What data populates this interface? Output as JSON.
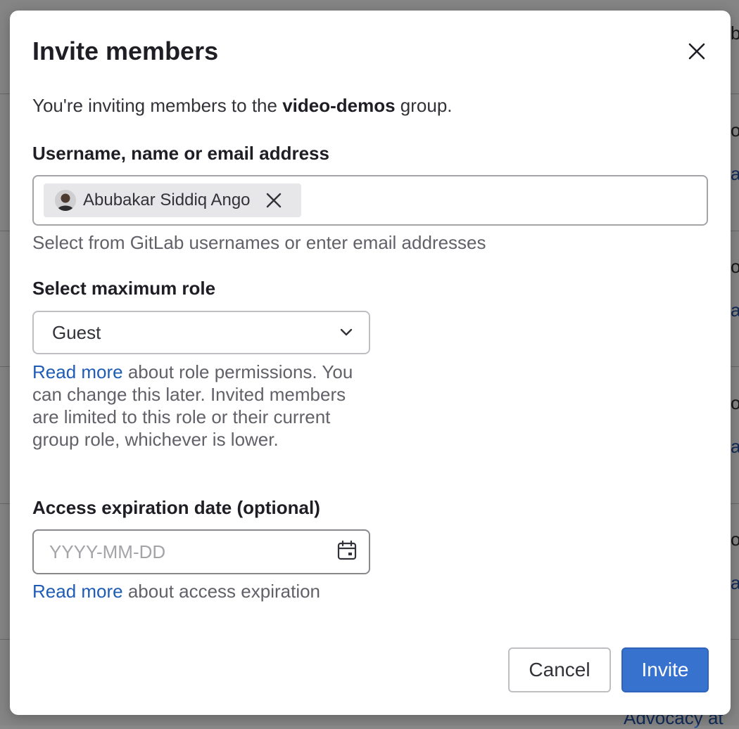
{
  "background": {
    "fragments": [
      "b",
      "o",
      "at",
      "o",
      "at",
      "o",
      "at",
      "o",
      "at",
      "Advocacy at"
    ]
  },
  "modal": {
    "title": "Invite members",
    "intro_prefix": "You're inviting members to the ",
    "group_name": "video-demos",
    "intro_suffix": " group.",
    "username_label": "Username, name or email address",
    "selected_token": "Abubakar Siddiq Ango",
    "username_help": "Select from GitLab usernames or enter email addresses",
    "role_label": "Select maximum role",
    "role_value": "Guest",
    "role_help_link": "Read more",
    "role_help_text": " about role permissions. You can change this later. Invited members are limited to this role or their current group role, whichever is lower.",
    "expiration_label": "Access expiration date (optional)",
    "expiration_placeholder": "YYYY-MM-DD",
    "expiration_value": "",
    "expiration_help_link": "Read more",
    "expiration_help_text": " about access expiration",
    "cancel_label": "Cancel",
    "invite_label": "Invite"
  },
  "icons": {
    "close": "close-icon",
    "token_remove": "close-icon",
    "dropdown": "chevron-down-icon",
    "calendar": "calendar-icon"
  },
  "colors": {
    "primary": "#3872cf",
    "link": "#1f5cb5"
  }
}
